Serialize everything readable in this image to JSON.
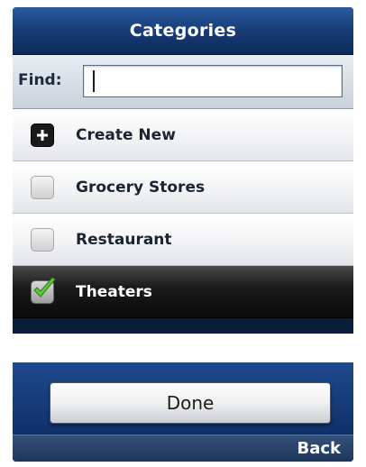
{
  "header": {
    "title": "Categories"
  },
  "find": {
    "label": "Find:",
    "value": "",
    "placeholder": ""
  },
  "list": {
    "items": [
      {
        "label": "Create New",
        "state": "add",
        "icon": "plus-icon"
      },
      {
        "label": "Grocery Stores",
        "state": "unchecked",
        "icon": "checkbox-icon"
      },
      {
        "label": "Restaurant",
        "state": "unchecked",
        "icon": "checkbox-icon"
      },
      {
        "label": "Theaters",
        "state": "checked",
        "icon": "checkmark-icon"
      }
    ],
    "selected_index": 3
  },
  "footer": {
    "done_label": "Done",
    "back_label": "Back"
  },
  "colors": {
    "title_bar": "#1a3f7a",
    "selected_row": "#1c1c1c",
    "checkmark": "#5cc83a",
    "bottom_area": "#123570"
  }
}
